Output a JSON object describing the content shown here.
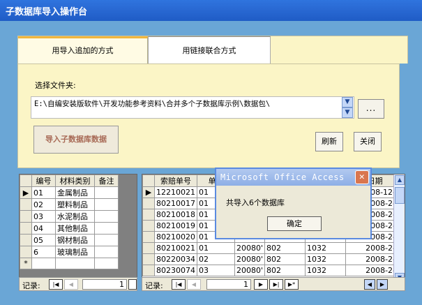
{
  "window": {
    "title": "子数据库导入操作台"
  },
  "tabs": [
    {
      "label": "用导入追加的方式"
    },
    {
      "label": "用链接联合方式"
    }
  ],
  "panel": {
    "folder_label": "选择文件夹:",
    "folder_path": "E:\\自编安装版软件\\开发功能参考资料\\合并多个子数据库示例\\数据包\\",
    "browse_label": "...",
    "import_label": "导入子数据库数据",
    "refresh_label": "刷新",
    "close_label": "关闭"
  },
  "left_grid": {
    "headers": [
      "编号",
      "材料类别",
      "备注"
    ],
    "rows": [
      [
        "01",
        "金属制品",
        ""
      ],
      [
        "02",
        "塑料制品",
        ""
      ],
      [
        "03",
        "水泥制品",
        ""
      ],
      [
        "04",
        "其他制品",
        ""
      ],
      [
        "05",
        "钢材制品",
        ""
      ],
      [
        "6",
        "玻璃制品",
        ""
      ]
    ],
    "new_row_marker": "*",
    "current_row_marker": "▶",
    "nav": {
      "label": "记录:",
      "record": "1"
    }
  },
  "right_grid": {
    "headers": [
      "索赔单号",
      "单据",
      "",
      "",
      "",
      "...日期"
    ],
    "rows": [
      [
        "12210021",
        "01",
        "",
        "",
        "",
        "2008-12-"
      ],
      [
        "80210017",
        "01",
        "",
        "",
        "",
        "2008-2-"
      ],
      [
        "80210018",
        "01",
        "",
        "",
        "",
        "2008-2-"
      ],
      [
        "80210019",
        "01",
        "",
        "",
        "",
        "2008-2-"
      ],
      [
        "80210020",
        "01",
        "",
        "",
        "",
        "2008-2-"
      ],
      [
        "80210021",
        "01",
        "20080'",
        "802",
        "1032",
        "2008-2-"
      ],
      [
        "80220034",
        "02",
        "20080'",
        "802",
        "1032",
        "2008-2-"
      ],
      [
        "80230074",
        "03",
        "20080'",
        "802",
        "1032",
        "2008-2-"
      ]
    ],
    "current_row_marker": "▶",
    "nav": {
      "label": "记录:",
      "record": "1"
    }
  },
  "dialog": {
    "title": "Microsoft Office Access",
    "message": "共导入6个数据库",
    "ok_label": "确定",
    "close_glyph": "✕"
  }
}
